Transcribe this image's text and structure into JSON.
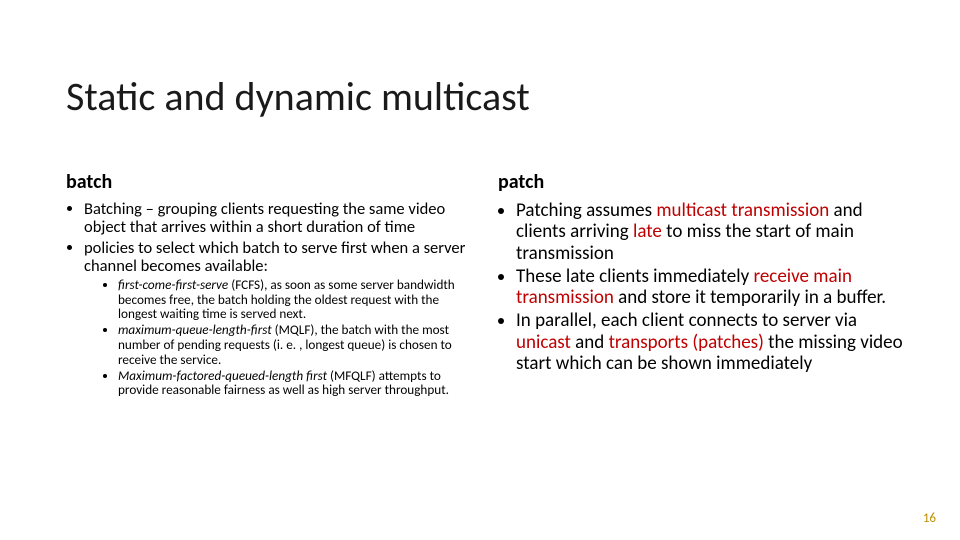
{
  "title": "Static and dynamic multicast",
  "left": {
    "heading": "batch",
    "b1_pre": "Batching – grouping clients  requesting the same video object that arrives within a short duration of time",
    "b2": "policies to select which batch to serve first when a server channel becomes available:",
    "s1_term": "first-come-first-serve",
    "s1_abbr": " (FCFS)",
    "s1_rest": ", as soon as some server bandwidth becomes free, the batch holding ",
    "s1_oldest": "the oldest",
    "s1_tail": " request with the longest waiting time is served next.",
    "s2_term": "maximum-queue-length-first",
    "s2_rest": " (MQLF), the batch with the most number of pending requests (i. e. , longest queue) is chosen to receive the service.",
    "s3_term": "Maximum-factored-queued-length first",
    "s3_rest": " (MFQLF) attempts to provide reasonable fairness as well as high server throughput."
  },
  "right": {
    "heading": "patch",
    "b1_a": "Patching assumes ",
    "b1_m": "multicast transmission",
    "b1_b": " and clients arriving ",
    "b1_late": "late",
    "b1_c": " to miss the start of main transmission",
    "b2_a": "These late clients immediately ",
    "b2_r": "receive main transmission",
    "b2_b": " and store it temporarily in a buffer.",
    "b3_a": "In parallel, each client connects to server via ",
    "b3_u": "unicast",
    "b3_b": " and ",
    "b3_t": "transports (patches)",
    "b3_c": " the missing video start which can be shown immediately"
  },
  "page_number": "16"
}
